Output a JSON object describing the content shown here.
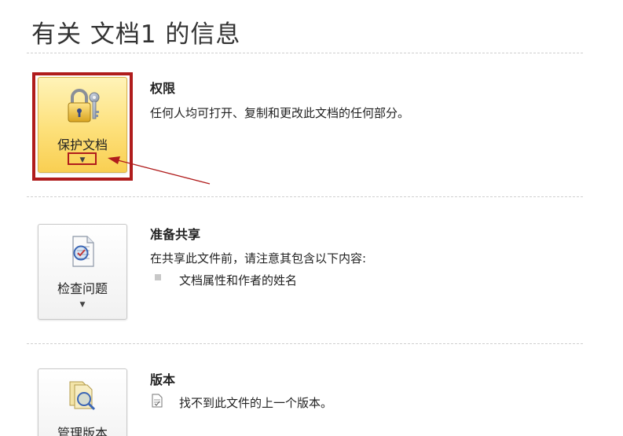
{
  "header": {
    "title": "有关 文档1 的信息"
  },
  "sections": [
    {
      "button_label": "保护文档",
      "button_icon": "lock-key-icon",
      "title": "权限",
      "description": "任何人均可打开、复制和更改此文档的任何部分。"
    },
    {
      "button_label": "检查问题",
      "button_icon": "inspect-document-icon",
      "title": "准备共享",
      "description": "在共享此文件前，请注意其包含以下内容:",
      "bullets": [
        "文档属性和作者的姓名"
      ]
    },
    {
      "button_label": "管理版本",
      "button_icon": "versions-icon",
      "title": "版本",
      "description": "找不到此文件的上一个版本。",
      "description_icon": "page-icon"
    }
  ],
  "colors": {
    "highlight": "#b01c1c",
    "active_button": "#fde07a"
  }
}
